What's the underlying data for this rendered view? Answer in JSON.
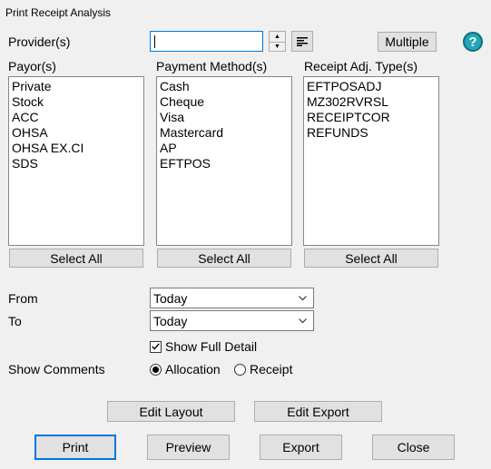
{
  "window": {
    "title": "Print Receipt Analysis"
  },
  "provider": {
    "label": "Provider(s)",
    "value": "",
    "multiple_label": "Multiple"
  },
  "payor": {
    "label": "Payor(s)",
    "items": [
      "Private",
      "Stock",
      "ACC",
      "OHSA",
      "OHSA EX.CI",
      "SDS"
    ],
    "select_all": "Select All"
  },
  "payment": {
    "label": "Payment Method(s)",
    "items": [
      "Cash",
      "Cheque",
      "Visa",
      "Mastercard",
      "AP",
      "EFTPOS"
    ],
    "select_all": "Select All"
  },
  "receipt_adj": {
    "label": "Receipt Adj. Type(s)",
    "items": [
      "EFTPOSADJ",
      "MZ302RVRSL",
      "RECEIPTCOR",
      "REFUNDS"
    ],
    "select_all": "Select All"
  },
  "from": {
    "label": "From",
    "value": "Today"
  },
  "to": {
    "label": "To",
    "value": "Today"
  },
  "show_full_detail": {
    "label": "Show Full Detail",
    "checked": true
  },
  "show_comments": {
    "label": "Show Comments",
    "options": [
      "Allocation",
      "Receipt"
    ],
    "selected": "Allocation"
  },
  "buttons": {
    "edit_layout": "Edit Layout",
    "edit_export": "Edit Export",
    "print": "Print",
    "preview": "Preview",
    "export": "Export",
    "close": "Close"
  },
  "icons": {
    "help": "help-icon",
    "list": "list-align-icon",
    "spin": "spin-arrows-icon",
    "dropdown": "chevron-down-icon"
  },
  "colors": {
    "accent": "#0078d7",
    "help": "#1fa8b7",
    "background": "#f0f0f0"
  }
}
